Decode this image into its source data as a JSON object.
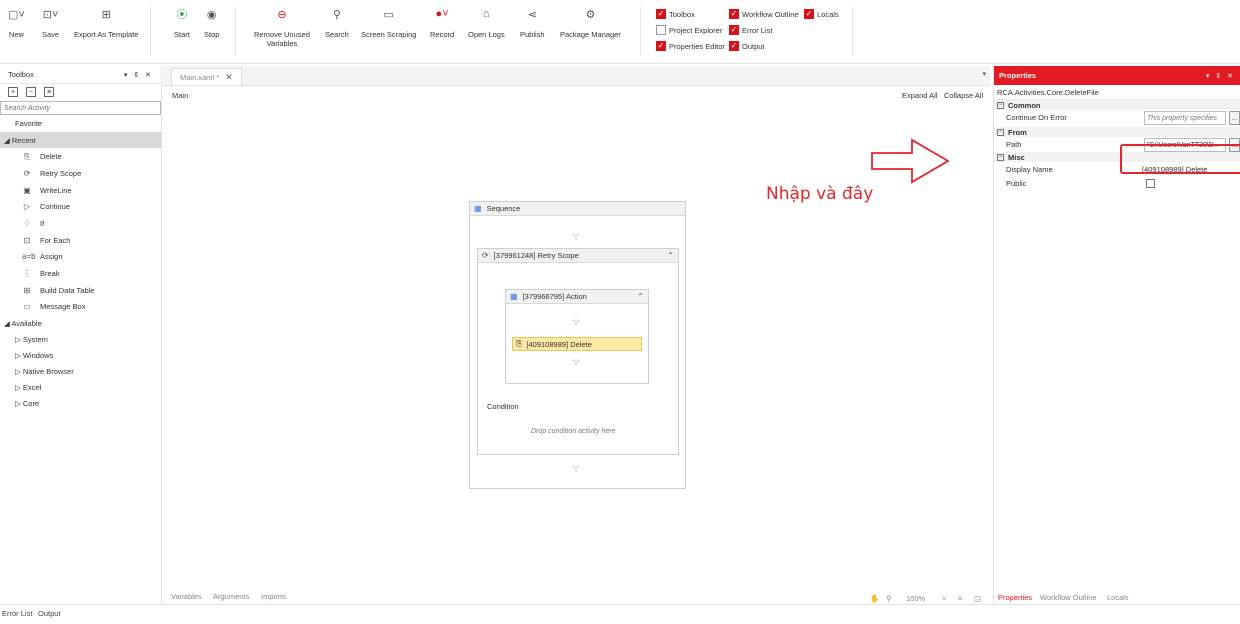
{
  "ribbon": {
    "new": "New",
    "save": "Save",
    "export": "Export As Template",
    "start": "Start",
    "stop": "Stop",
    "remove_unused": "Remove Unused\nVariables",
    "search": "Search",
    "screen_scraping": "Screen Scraping",
    "record": "Record",
    "open_logs": "Open Logs",
    "publish": "Publish",
    "package_manager": "Package Manager",
    "checks": {
      "toolbox": "Toolbox",
      "workflow_outline": "Workflow Outline",
      "locals": "Locals",
      "project_explorer": "Project Explorer",
      "error_list": "Error List",
      "properties_editor": "Properties Editor",
      "output": "Output"
    }
  },
  "toolbox": {
    "title": "Toolbox",
    "search_placeholder": "Search Activity",
    "favorite": "Favorite",
    "recent": "◢ Recent",
    "recent_items": [
      "Delete",
      "Retry Scope",
      "WriteLine",
      "Continue",
      "If",
      "For Each",
      "Assign",
      "Break",
      "Build Data Table",
      "Message Box"
    ],
    "available": "◢ Available",
    "available_items": [
      "▷ System",
      "▷ Windows",
      "▷ Native Browser",
      "▷ Excel",
      "▷ Core"
    ]
  },
  "designer": {
    "tab": "Main.xaml *",
    "breadcrumb": "Main",
    "expand_all": "Expand All",
    "collapse_all": "Collapse All",
    "sequence": "Sequence",
    "retry_scope": "[379961248] Retry Scope",
    "action": "[379966795] Action",
    "delete": "[409108989] Delete",
    "condition": "Condition",
    "drop_hint": "Drop condition activity here",
    "bottom": {
      "variables": "Variables",
      "arguments": "Arguments",
      "imports": "Imports"
    },
    "zoom": "100%"
  },
  "properties": {
    "title": "Properties",
    "type": "RCA.Activities.Core.DeleteFile",
    "cat_common": "Common",
    "continue_on_error": "Continue On Error",
    "continue_hint": "This property specifies",
    "cat_from": "From",
    "path": "Path",
    "path_value": "\"C:\\Users\\VanTT20\\D...",
    "cat_misc": "Misc",
    "display_name": "Display Name",
    "display_value": "[409108989] Delete",
    "public": "Public",
    "tabs": {
      "properties": "Properties",
      "workflow_outline": "Workflow Outline",
      "locals": "Locals"
    }
  },
  "status": {
    "error_list": "Error List",
    "output": "Output"
  },
  "annotation": "Nhập và đây",
  "colors": {
    "accent": "#e21a22",
    "delete_fill": "#fde8a4"
  }
}
